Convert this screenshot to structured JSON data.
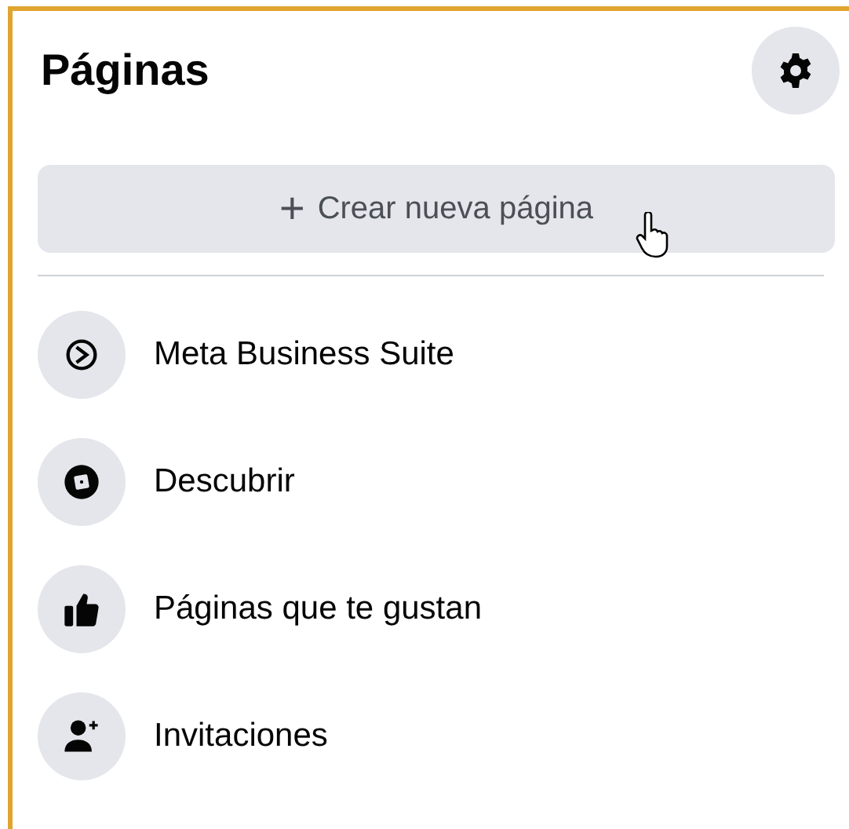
{
  "header": {
    "title": "Páginas"
  },
  "create_button": {
    "icon": "+",
    "label": "Crear nueva página"
  },
  "menu": [
    {
      "kind": "suite",
      "label": "Meta Business Suite"
    },
    {
      "kind": "discover",
      "label": "Descubrir"
    },
    {
      "kind": "liked",
      "label": "Páginas que te gustan"
    },
    {
      "kind": "invites",
      "label": "Invitaciones"
    }
  ]
}
